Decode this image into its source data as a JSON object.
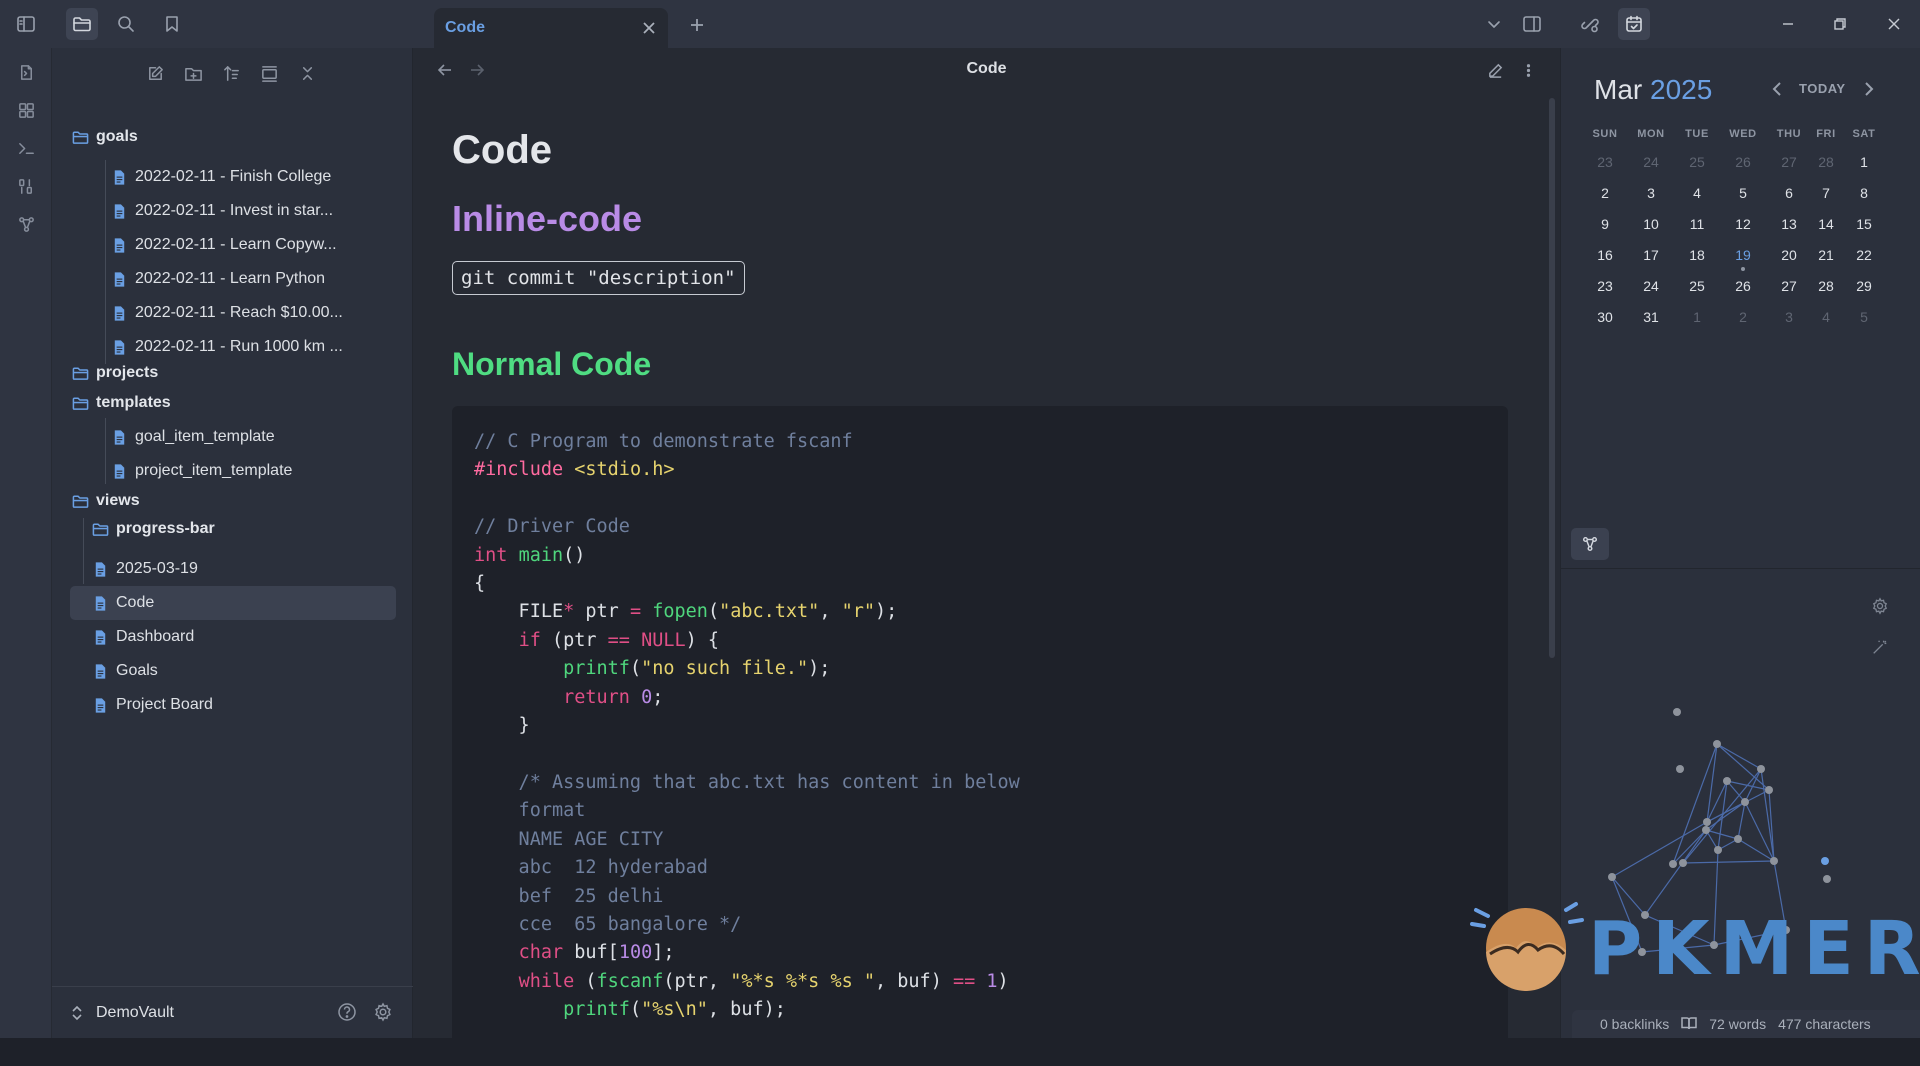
{
  "tab": {
    "title": "Code"
  },
  "editor": {
    "header_title": "Code",
    "note_title": "Code",
    "heading_inline": "Inline-code",
    "inline_code": "git commit \"description\"",
    "heading_normal": "Normal Code"
  },
  "sidebar": {
    "items": [
      {
        "label": "goals",
        "kind": "folder"
      },
      {
        "label": "2022-02-11 - Finish College",
        "kind": "file"
      },
      {
        "label": "2022-02-11 - Invest in star...",
        "kind": "file"
      },
      {
        "label": "2022-02-11 - Learn Copyw...",
        "kind": "file"
      },
      {
        "label": "2022-02-11 - Learn Python",
        "kind": "file"
      },
      {
        "label": "2022-02-11 - Reach $10.00...",
        "kind": "file"
      },
      {
        "label": "2022-02-11 - Run 1000 km ...",
        "kind": "file"
      },
      {
        "label": "projects",
        "kind": "folder"
      },
      {
        "label": "templates",
        "kind": "folder"
      },
      {
        "label": "goal_item_template",
        "kind": "file"
      },
      {
        "label": "project_item_template",
        "kind": "file"
      },
      {
        "label": "views",
        "kind": "folder"
      },
      {
        "label": "progress-bar",
        "kind": "folder"
      },
      {
        "label": "2025-03-19",
        "kind": "file"
      },
      {
        "label": "Code",
        "kind": "file",
        "selected": true
      },
      {
        "label": "Dashboard",
        "kind": "file"
      },
      {
        "label": "Goals",
        "kind": "file"
      },
      {
        "label": "Project Board",
        "kind": "file"
      }
    ],
    "vault_name": "DemoVault"
  },
  "code_lines": [
    "// C Program to demonstrate fscanf",
    "#include <stdio.h>",
    "",
    "// Driver Code",
    "int main()",
    "{",
    "    FILE* ptr = fopen(\"abc.txt\", \"r\");",
    "    if (ptr == NULL) {",
    "        printf(\"no such file.\");",
    "        return 0;",
    "    }",
    "",
    "    /* Assuming that abc.txt has content in below",
    "    format",
    "    NAME AGE CITY",
    "    abc  12 hyderabad",
    "    bef  25 delhi",
    "    cce  65 bangalore */",
    "    char buf[100];",
    "    while (fscanf(ptr, \"%*s %*s %s \", buf) == 1)",
    "        printf(\"%s\\n\", buf);"
  ],
  "calendar": {
    "month": "Mar",
    "year": "2025",
    "today_label": "TODAY",
    "weekdays": [
      "SUN",
      "MON",
      "TUE",
      "WED",
      "THU",
      "FRI",
      "SAT"
    ],
    "weeks": [
      [
        "23",
        "24",
        "25",
        "26",
        "27",
        "28",
        "1"
      ],
      [
        "2",
        "3",
        "4",
        "5",
        "6",
        "7",
        "8"
      ],
      [
        "9",
        "10",
        "11",
        "12",
        "13",
        "14",
        "15"
      ],
      [
        "16",
        "17",
        "18",
        "19",
        "20",
        "21",
        "22"
      ],
      [
        "23",
        "24",
        "25",
        "26",
        "27",
        "28",
        "29"
      ],
      [
        "30",
        "31",
        "1",
        "2",
        "3",
        "4",
        "5"
      ]
    ],
    "today": "19"
  },
  "status": {
    "backlinks": "0 backlinks",
    "words": "72 words",
    "characters": "477 characters"
  },
  "watermark": "PKMER",
  "colors": {
    "accent": "#6a9fe3",
    "heading_inline": "#b98be6",
    "heading_normal": "#4fdc82",
    "background": "#262a33"
  }
}
